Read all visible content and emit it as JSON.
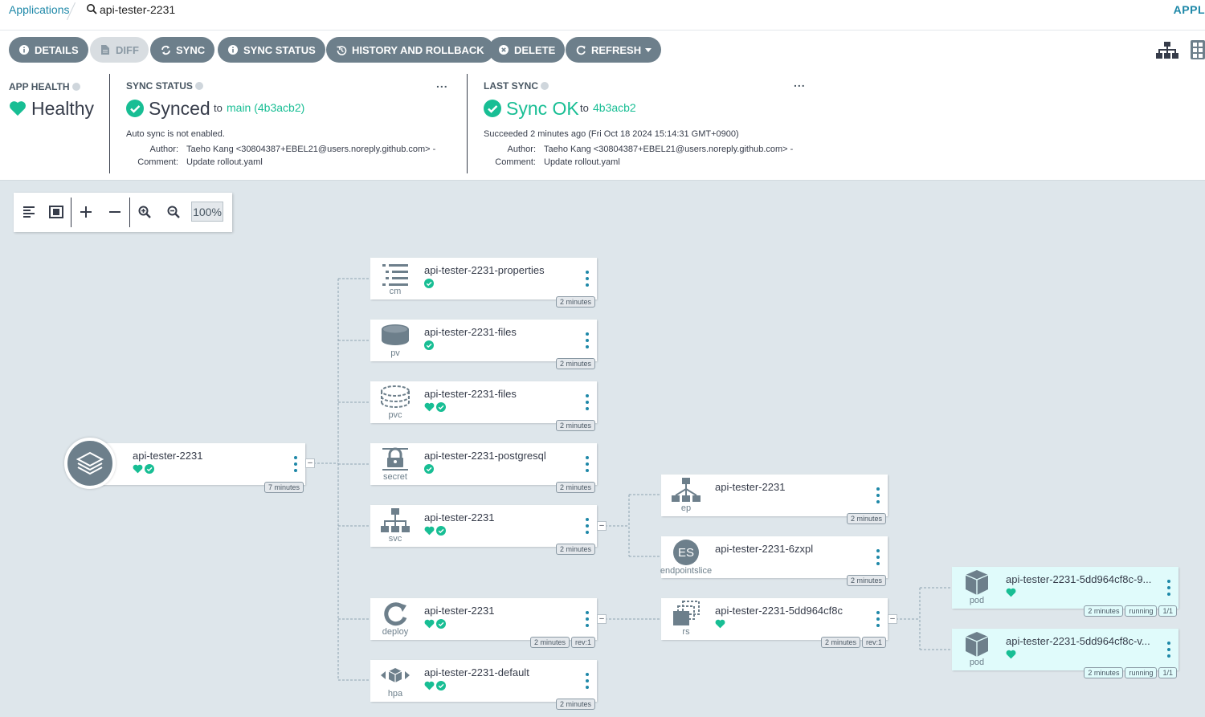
{
  "breadcrumb": {
    "applications": "Applications",
    "current": "api-tester-2231",
    "right_label": "APPL"
  },
  "toolbar": {
    "details": "DETAILS",
    "diff": "DIFF",
    "sync": "SYNC",
    "sync_status": "SYNC STATUS",
    "history": "HISTORY AND ROLLBACK",
    "delete": "DELETE",
    "refresh": "REFRESH"
  },
  "status": {
    "app_health_label": "APP HEALTH",
    "health": "Healthy",
    "sync_status_label": "SYNC STATUS",
    "synced": "Synced",
    "to": "to",
    "synced_rev": "main (4b3acb2)",
    "auto_sync": "Auto sync is not enabled.",
    "author_label": "Author:",
    "author": "Taeho Kang <30804387+EBEL21@users.noreply.github.com> -",
    "comment_label": "Comment:",
    "comment": "Update rollout.yaml",
    "last_sync_label": "LAST SYNC",
    "sync_ok": "Sync OK",
    "last_rev": "4b3acb2",
    "succeeded": "Succeeded 2 minutes ago (Fri Oct 18 2024 15:14:31 GMT+0900)",
    "more": "..."
  },
  "canvas": {
    "zoom": "100%",
    "app_node": {
      "name": "api-tester-2231",
      "age": "7 minutes"
    },
    "nodes": [
      {
        "name": "api-tester-2231-properties",
        "kind": "cm",
        "age": "2 minutes"
      },
      {
        "name": "api-tester-2231-files",
        "kind": "pv",
        "age": "2 minutes"
      },
      {
        "name": "api-tester-2231-files",
        "kind": "pvc",
        "age": "2 minutes"
      },
      {
        "name": "api-tester-2231-postgresql",
        "kind": "secret",
        "age": "2 minutes"
      },
      {
        "name": "api-tester-2231",
        "kind": "svc",
        "age": "2 minutes"
      },
      {
        "name": "api-tester-2231",
        "kind": "deploy",
        "age": "2 minutes",
        "rev": "rev:1"
      },
      {
        "name": "api-tester-2231-default",
        "kind": "hpa",
        "age": "2 minutes"
      },
      {
        "name": "api-tester-2231",
        "kind": "ep",
        "age": "2 minutes"
      },
      {
        "name": "api-tester-2231-6zxpl",
        "kind": "endpointslice",
        "badge": "ES",
        "age": "2 minutes"
      },
      {
        "name": "api-tester-2231-5dd964cf8c",
        "kind": "rs",
        "age": "2 minutes",
        "rev": "rev:1"
      },
      {
        "name": "api-tester-2231-5dd964cf8c-9...",
        "kind": "pod",
        "age": "2 minutes",
        "state": "running",
        "ready": "1/1"
      },
      {
        "name": "api-tester-2231-5dd964cf8c-v...",
        "kind": "pod",
        "age": "2 minutes",
        "state": "running",
        "ready": "1/1"
      }
    ]
  },
  "colors": {
    "healthy": "#18be94",
    "accent": "#1e88a8",
    "button": "#6d7f8b",
    "pod_bg": "#e0fbfb"
  }
}
